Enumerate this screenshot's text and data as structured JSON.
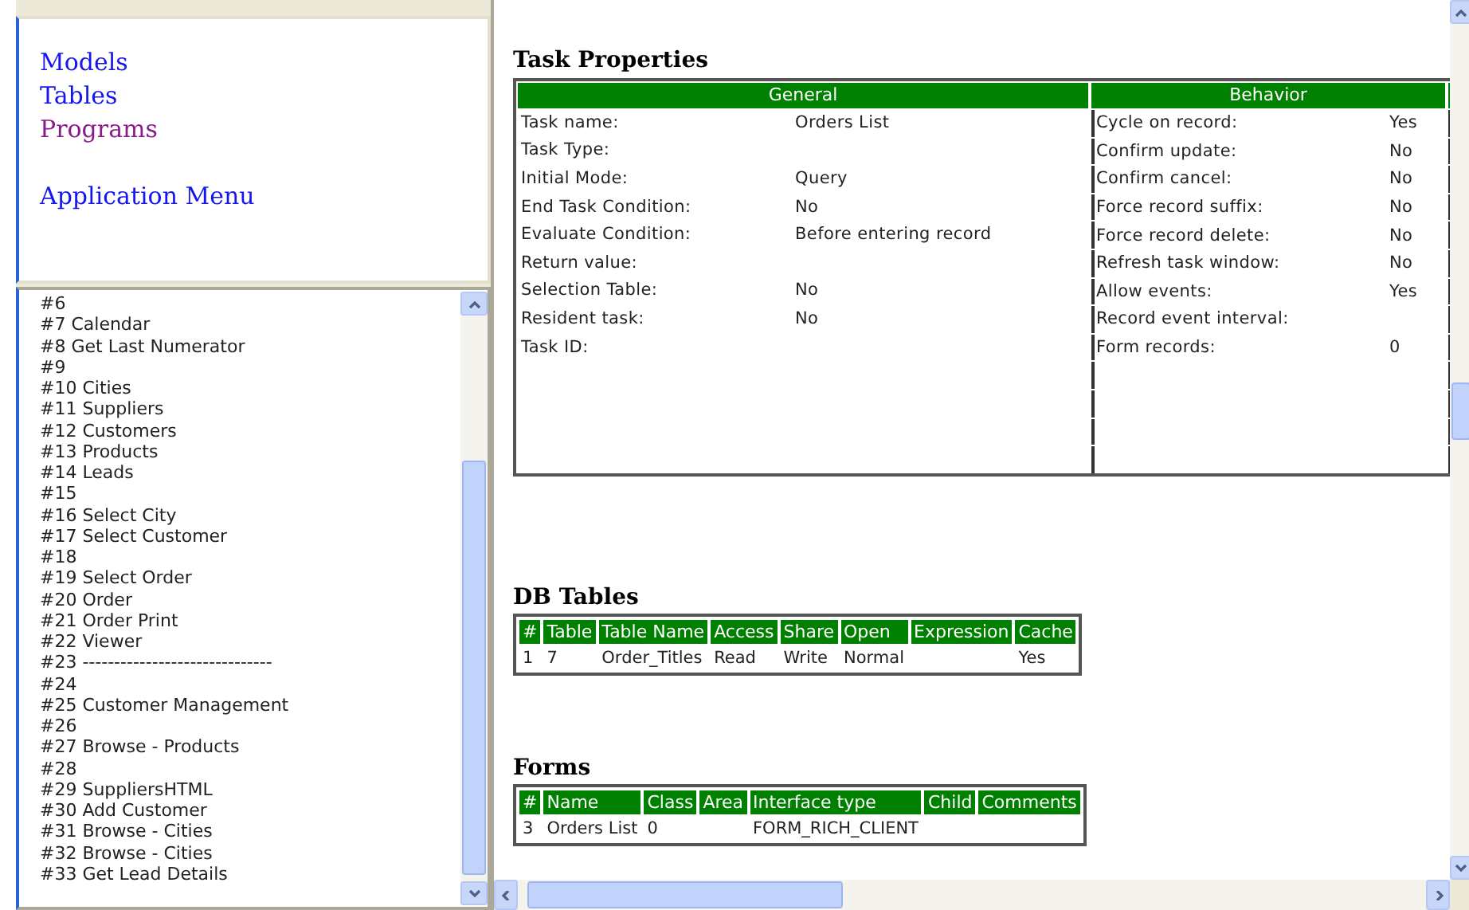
{
  "nav_links": [
    [
      {
        "label": "Models",
        "visited": false
      },
      {
        "label": "Tables",
        "visited": false
      },
      {
        "label": "Programs",
        "visited": true
      }
    ],
    [
      {
        "label": "Application Menu",
        "visited": false
      }
    ]
  ],
  "programs": [
    "#6",
    "#7 Calendar",
    "#8 Get Last Numerator",
    "#9",
    "#10 Cities",
    "#11 Suppliers",
    "#12 Customers",
    "#13 Products",
    "#14 Leads",
    "#15",
    "#16 Select City",
    "#17 Select Customer",
    "#18",
    "#19 Select Order",
    "#20 Order",
    "#21 Order Print",
    "#22 Viewer",
    "#23 ------------------------------",
    "#24",
    "#25 Customer Management",
    "#26",
    "#27 Browse - Products",
    "#28",
    "#29 SuppliersHTML",
    "#30 Add Customer",
    "#31 Browse - Cities",
    "#32 Browse - Cities",
    "#33 Get Lead Details"
  ],
  "task_properties": {
    "title": "Task Properties",
    "general": {
      "header": "General",
      "rows": [
        {
          "label": "Task name:",
          "value": "Orders List"
        },
        {
          "label": "Task Type:"
        },
        {
          "label": "Initial Mode:",
          "value": "Query"
        },
        {
          "label": "End Task Condition:",
          "value": "No"
        },
        {
          "label": "Evaluate Condition:",
          "value": "Before entering record"
        },
        {
          "label": "Return value:"
        },
        {
          "label": "Selection Table:",
          "value": "No"
        },
        {
          "label": "Resident task:",
          "value": "No"
        },
        {
          "label": "Task ID:"
        }
      ]
    },
    "behavior": {
      "header": "Behavior",
      "rows": [
        {
          "label": "Cycle on record:",
          "value": "Yes"
        },
        {
          "label": "Confirm update:",
          "value": "No"
        },
        {
          "label": "Confirm cancel:",
          "value": "No"
        },
        {
          "label": "Force record suffix:",
          "value": "No"
        },
        {
          "label": "Force record delete:",
          "value": "No"
        },
        {
          "label": "Refresh task window:",
          "value": "No"
        },
        {
          "label": "Allow events:",
          "value": "Yes"
        },
        {
          "label": "Record event interval:"
        },
        {
          "label": "Form records:",
          "value": "0"
        }
      ]
    }
  },
  "db_tables": {
    "title": "DB Tables",
    "columns": [
      "#",
      "Table",
      "Table Name",
      "Access",
      "Share",
      "Open",
      "Expression",
      "Cache"
    ],
    "rows": [
      [
        "1",
        "7",
        "Order_Titles",
        "Read",
        "Write",
        "Normal",
        "",
        "Yes"
      ]
    ]
  },
  "forms": {
    "title": "Forms",
    "columns": [
      "#",
      "Name",
      "Class",
      "Area",
      "Interface type",
      "Child",
      "Comments"
    ],
    "rows": [
      [
        "3",
        "Orders List",
        "0",
        "",
        "FORM_RICH_CLIENT",
        "",
        ""
      ]
    ]
  }
}
